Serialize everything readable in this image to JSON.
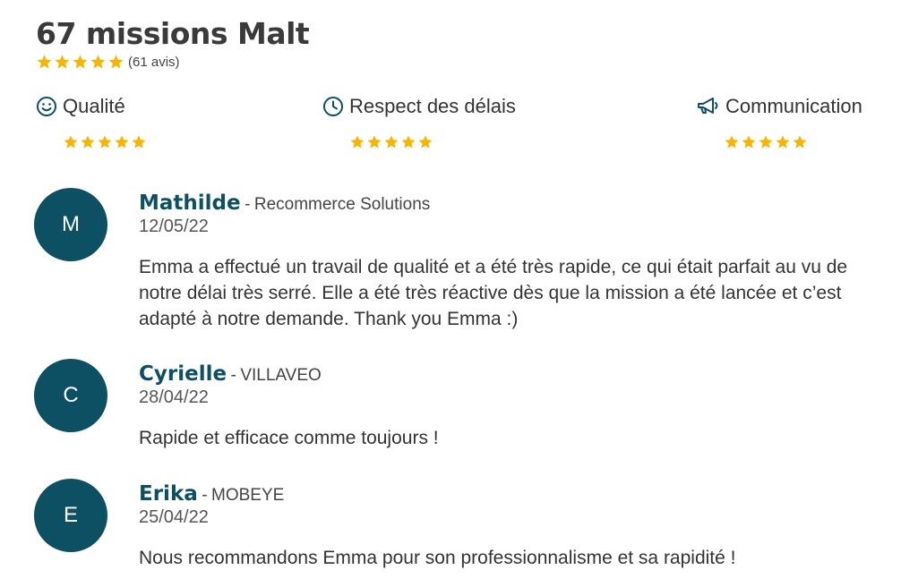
{
  "header": {
    "title": "67 missions Malt",
    "rating_stars": 5,
    "review_count": "(61 avis)",
    "star_color": "#f7b500"
  },
  "criteria": [
    {
      "label": "Qualité",
      "icon": "smiley-icon",
      "stars": 5
    },
    {
      "label": "Respect des délais",
      "icon": "clock-icon",
      "stars": 5
    },
    {
      "label": "Communication",
      "icon": "megaphone-icon",
      "stars": 5
    }
  ],
  "reviews": [
    {
      "initial": "M",
      "name": "Mathilde",
      "separator": "-",
      "company": "Recommerce Solutions",
      "date": "12/05/22",
      "text": "Emma a effectué un travail de qualité et a été très rapide, ce qui était parfait au vu de notre délai très serré. Elle a été très réactive dès que la mission a été lancée et c’est adapté à notre demande. Thank you Emma :)"
    },
    {
      "initial": "C",
      "name": "Cyrielle",
      "separator": "-",
      "company": "VILLAVEO",
      "date": "28/04/22",
      "text": "Rapide et efficace comme toujours !"
    },
    {
      "initial": "E",
      "name": "Erika",
      "separator": "-",
      "company": "MOBEYE",
      "date": "25/04/22",
      "text": "Nous recommandons Emma pour son professionnalisme et sa rapidité !"
    }
  ],
  "colors": {
    "accent": "#0d4f63",
    "star": "#f7b500",
    "text": "#333333"
  }
}
